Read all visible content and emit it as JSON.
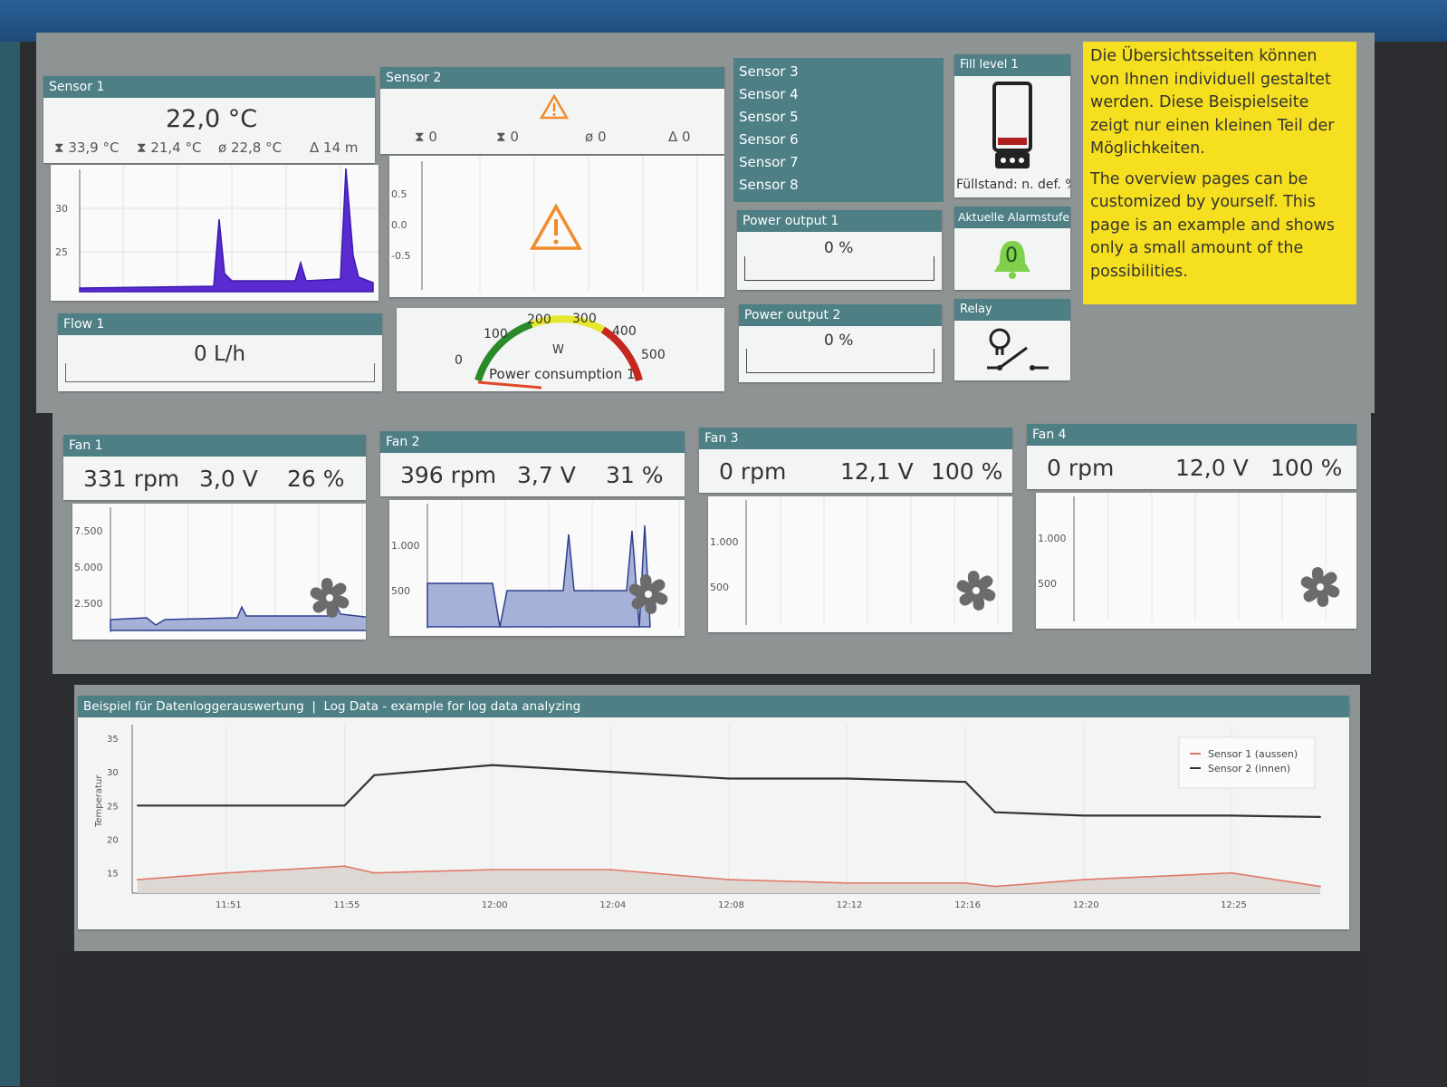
{
  "sensor1": {
    "title": "Sensor 1",
    "value": "22,0 °C",
    "max": "33,9 °C",
    "min": "21,4 °C",
    "avg": "22,8 °C",
    "interval": "14 m",
    "y_ticks": [
      "30",
      "25"
    ]
  },
  "sensor2": {
    "title": "Sensor 2",
    "max": "0",
    "min": "0",
    "avg": "0",
    "interval": "0",
    "y_ticks": [
      "0.5",
      "0.0",
      "-0.5"
    ]
  },
  "sensor_list": [
    "Sensor 3",
    "Sensor 4",
    "Sensor 5",
    "Sensor 6",
    "Sensor 7",
    "Sensor 8"
  ],
  "fill_level": {
    "title": "Fill level 1",
    "label": "Füllstand: n. def. %"
  },
  "alarm": {
    "title": "Aktuelle Alarmstufe",
    "value": "0"
  },
  "relay": {
    "title": "Relay"
  },
  "power1": {
    "title": "Power output 1",
    "value": "0 %"
  },
  "power2": {
    "title": "Power output 2",
    "value": "0 %"
  },
  "flow": {
    "title": "Flow 1",
    "value": "0 L/h"
  },
  "gauge": {
    "label": "Power consumption 1",
    "unit": "W",
    "ticks": [
      "0",
      "100",
      "200",
      "300",
      "400",
      "500"
    ],
    "value": 0
  },
  "note": {
    "de": "Die Übersichtsseiten können von Ihnen individuell gestaltet werden. Diese Beispielseite zeigt nur einen kleinen Teil der Möglichkeiten.",
    "en": "The overview pages can be customized by yourself. This page is an example and shows only a small amount of the possibilities."
  },
  "fans": [
    {
      "title": "Fan 1",
      "rpm": "331 rpm",
      "volt": "3,0 V",
      "pct": "26 %",
      "y_ticks": [
        "7.500",
        "5.000",
        "2.500"
      ]
    },
    {
      "title": "Fan 2",
      "rpm": "396 rpm",
      "volt": "3,7 V",
      "pct": "31 %",
      "y_ticks": [
        "1.000",
        "500"
      ]
    },
    {
      "title": "Fan 3",
      "rpm": "0 rpm",
      "volt": "12,1 V",
      "pct": "100 %",
      "y_ticks": [
        "1.000",
        "500"
      ]
    },
    {
      "title": "Fan 4",
      "rpm": "0 rpm",
      "volt": "12,0 V",
      "pct": "100 %",
      "y_ticks": [
        "1.000",
        "500"
      ]
    }
  ],
  "log": {
    "title": "Beispiel für Datenloggerauswertung  |  Log Data - example for log data analyzing",
    "ylabel": "Temperatur",
    "y_ticks": [
      "35",
      "30",
      "25",
      "20",
      "15"
    ],
    "x_ticks": [
      "11:51",
      "11:55",
      "12:00",
      "12:04",
      "12:08",
      "12:12",
      "12:16",
      "12:20",
      "12:25"
    ],
    "legend": [
      "Sensor 1 (aussen)",
      "Sensor 2 (innen)"
    ]
  },
  "chart_data": {
    "type": "line",
    "title": "Beispiel für Datenloggerauswertung  |  Log Data - example for log data analyzing",
    "xlabel": "",
    "ylabel": "Temperatur",
    "ylim": [
      12,
      37
    ],
    "x": [
      "11:48",
      "11:51",
      "11:55",
      "11:56",
      "12:00",
      "12:04",
      "12:08",
      "12:12",
      "12:16",
      "12:17",
      "12:20",
      "12:25",
      "12:28"
    ],
    "series": [
      {
        "name": "Sensor 1 (aussen)",
        "color": "#e07a6a",
        "values": [
          14,
          15,
          16,
          15,
          15.5,
          15.5,
          14,
          13.5,
          13.5,
          13,
          14,
          15,
          13
        ]
      },
      {
        "name": "Sensor 2 (innen)",
        "color": "#333333",
        "values": [
          25,
          25,
          25,
          29.5,
          31,
          30,
          29,
          29,
          28.5,
          24,
          23.5,
          23.5,
          23.3
        ]
      }
    ],
    "legend_position": "top-right",
    "grid": true
  }
}
